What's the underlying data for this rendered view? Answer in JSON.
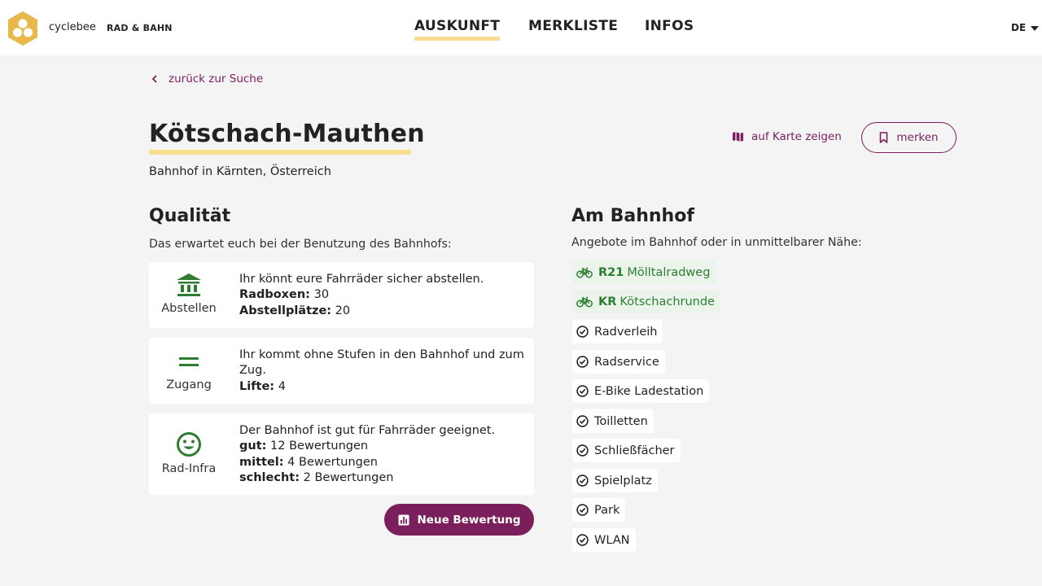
{
  "header": {
    "brand": "cyclebee",
    "sub_brand": "RAD & BAHN",
    "nav": [
      "AUSKUNFT",
      "MERKLISTE",
      "INFOS"
    ],
    "language": "DE"
  },
  "back_link": "zurück zur Suche",
  "station": {
    "title": "Kötschach-Mauthen",
    "subtitle": "Bahnhof in Kärnten, Österreich"
  },
  "actions": {
    "map": "auf Karte zeigen",
    "bookmark": "merken"
  },
  "quality": {
    "heading": "Qualität",
    "intro": "Das erwartet euch bei der Benutzung des Bahnhofs:",
    "cards": [
      {
        "icon": "bank-icon",
        "label": "Abstellen",
        "text": "Ihr könnt eure Fahrräder sicher abstellen.",
        "facts": [
          {
            "k": "Radboxen:",
            "v": " 30"
          },
          {
            "k": "Abstellplätze:",
            "v": " 20"
          }
        ]
      },
      {
        "icon": "equals-icon",
        "label": "Zugang",
        "text": "Ihr kommt ohne Stufen in den Bahnhof und zum Zug.",
        "facts": [
          {
            "k": "Lifte:",
            "v": " 4"
          }
        ]
      },
      {
        "icon": "smiley-icon",
        "label": "Rad-Infra",
        "text": "Der Bahnhof ist gut für Fahrräder geeignet.",
        "facts": [
          {
            "k": "gut:",
            "v": " 12 Bewertungen"
          },
          {
            "k": "mittel:",
            "v": " 4 Bewertungen"
          },
          {
            "k": "schlecht:",
            "v": " 2 Bewertungen"
          }
        ]
      }
    ],
    "new_rating": "Neue Bewertung"
  },
  "station_offers": {
    "heading": "Am Bahnhof",
    "intro": "Angebote im Bahnhof oder in unmittelbarer Nähe:",
    "routes": [
      {
        "code": "R21",
        "name": "Mölltalradweg"
      },
      {
        "code": "KR",
        "name": "Kötschachrunde"
      }
    ],
    "amenities": [
      "Radverleih",
      "Radservice",
      "E-Bike Ladestation",
      "Toilletten",
      "Schließfächer",
      "Spielplatz",
      "Park",
      "WLAN"
    ]
  },
  "colors": {
    "accent": "#7a1f5c",
    "highlight": "#f8dd8e",
    "icon_green": "#2e7d32",
    "logo": "#e8b84b"
  }
}
